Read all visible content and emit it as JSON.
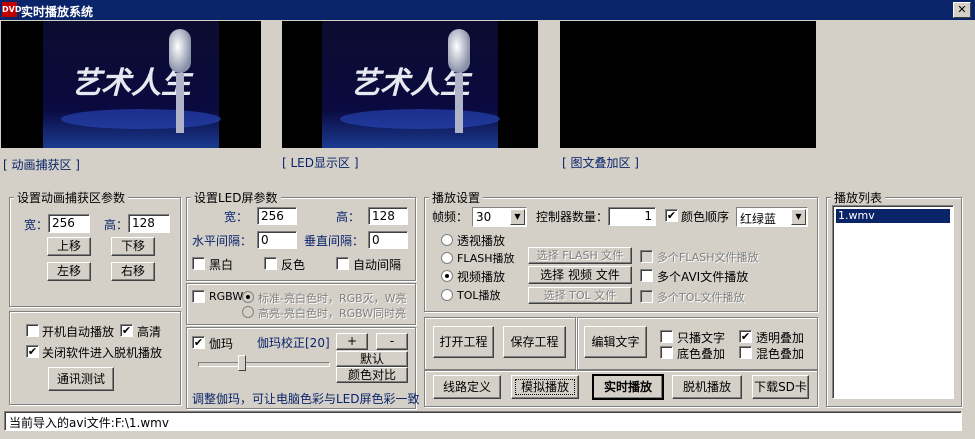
{
  "window": {
    "title": "实时播放系统",
    "icon_text": "DVD",
    "close_glyph": "✕"
  },
  "previews": {
    "capture": {
      "label": "[ 动画捕获区 ]",
      "logo_text": "艺术人生"
    },
    "led": {
      "label": "[ LED显示区 ]",
      "logo_text": "艺术人生"
    },
    "overlay": {
      "label": "[ 图文叠加区 ]"
    }
  },
  "capture_group": {
    "title": "设置动画捕获区参数",
    "width_label": "宽：",
    "width_value": "256",
    "height_label": "高：",
    "height_value": "128",
    "up": "上移",
    "down": "下移",
    "left": "左移",
    "right": "右移"
  },
  "options_group": {
    "autoplay": {
      "label": "开机自动播放",
      "checked": false
    },
    "hd": {
      "label": "高清",
      "checked": true
    },
    "offline_on_close": {
      "label": "关闭软件进入脱机播放",
      "checked": true
    },
    "comm_test": "通讯测试"
  },
  "led_group": {
    "title": "设置LED屏参数",
    "width_label": "宽：",
    "width_value": "256",
    "height_label": "高：",
    "height_value": "128",
    "hgap_label": "水平间隔：",
    "hgap_value": "0",
    "vgap_label": "垂直间隔：",
    "vgap_value": "0",
    "bw": {
      "label": "黑白",
      "checked": false
    },
    "invert": {
      "label": "反色",
      "checked": false
    },
    "auto_gap": {
      "label": "自动间隔",
      "checked": false
    }
  },
  "rgbw_group": {
    "rgbw": {
      "label": "RGBW",
      "checked": false
    },
    "standard": {
      "label": "标准-亮白色时，RGB灭，W亮",
      "selected": true
    },
    "bright": {
      "label": "高亮-亮白色时，RGBW同时亮",
      "selected": false
    }
  },
  "gamma_group": {
    "gamma": {
      "label": "伽玛",
      "checked": true
    },
    "correction_label": "伽玛校正[20]",
    "plus": "+",
    "minus": "-",
    "default": "默认",
    "color_compare": "颜色对比",
    "slider_value": 20,
    "hint": "调整伽玛，可让电脑色彩与LED屏色彩一致"
  },
  "play_group": {
    "title": "播放设置",
    "fps_label": "帧频：",
    "fps_value": "30",
    "ctrl_count_label": "控制器数量：",
    "ctrl_count_value": "1",
    "color_order": {
      "label": "颜色顺序",
      "checked": true
    },
    "color_order_value": "红绿蓝",
    "modes": [
      {
        "label": "透视播放",
        "selected": false
      },
      {
        "label": "FLASH播放",
        "selected": false
      },
      {
        "label": "视频播放",
        "selected": true
      },
      {
        "label": "TOL播放",
        "selected": false
      }
    ],
    "select_flash": "选择 FLASH 文件",
    "select_video": "选择 视频 文件",
    "select_tol": "选择 TOL 文件",
    "multi_flash": {
      "label": "多个FLASH文件播放",
      "checked": false
    },
    "multi_avi": {
      "label": "多个AVI文件播放",
      "checked": false
    },
    "multi_tol": {
      "label": "多个TOL文件播放",
      "checked": false
    }
  },
  "project_buttons": {
    "open": "打开工程",
    "save": "保存工程",
    "edit_text": "编辑文字"
  },
  "text_options": {
    "text_only": {
      "label": "只播文字",
      "checked": false
    },
    "transparent": {
      "label": "透明叠加",
      "checked": true
    },
    "bg_overlay": {
      "label": "底色叠加",
      "checked": false
    },
    "mix_overlay": {
      "label": "混色叠加",
      "checked": false
    }
  },
  "bottom_buttons": {
    "line_def": "线路定义",
    "simulate": "模拟播放",
    "realtime": "实时播放",
    "offline": "脱机播放",
    "download_sd": "下载SD卡"
  },
  "playlist": {
    "title": "播放列表",
    "items": [
      "1.wmv"
    ]
  },
  "status": {
    "text": "当前导入的avi文件:F:\\1.wmv"
  }
}
